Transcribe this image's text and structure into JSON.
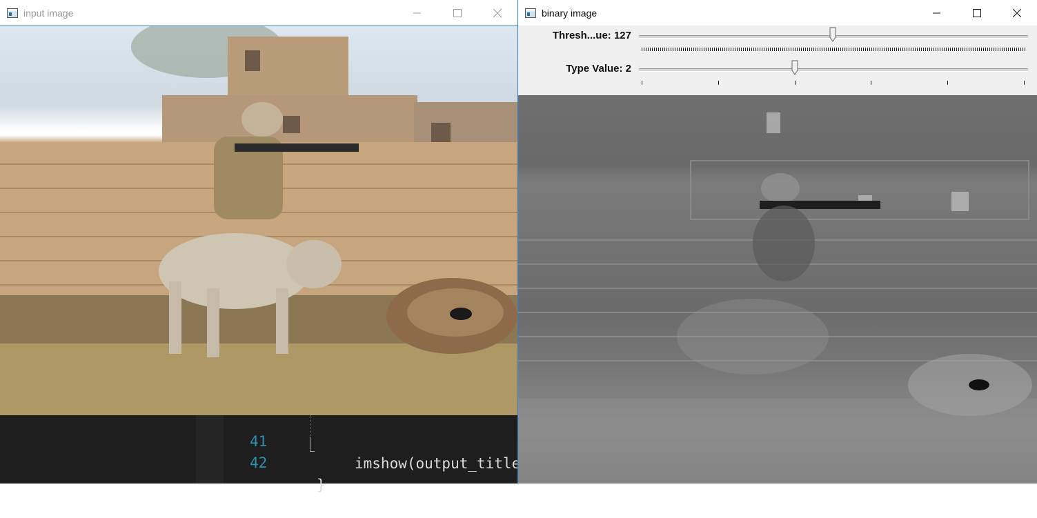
{
  "input_window": {
    "title": "input image",
    "controls": {
      "minimize": "minimize-icon",
      "maximize": "maximize-icon",
      "close": "close-icon"
    }
  },
  "editor": {
    "lines": [
      {
        "number": "41",
        "code": "imshow(output_title"
      },
      {
        "number": "42",
        "code": "}"
      }
    ],
    "colors": {
      "background": "#1e1e1e",
      "line_number": "#2b91af",
      "code": "#dcdcdc"
    }
  },
  "binary_window": {
    "title": "binary image",
    "controls": {
      "minimize": "minimize-icon",
      "maximize": "maximize-icon",
      "close": "close-icon"
    },
    "trackbars": [
      {
        "label": "Thresh...ue: 127",
        "value": 127,
        "max": 255
      },
      {
        "label": "Type Value: 2",
        "value": 2,
        "max": 5
      }
    ]
  },
  "colors": {
    "accent_border": "#2f7fc9",
    "panel_bg": "#f0f0f0"
  }
}
